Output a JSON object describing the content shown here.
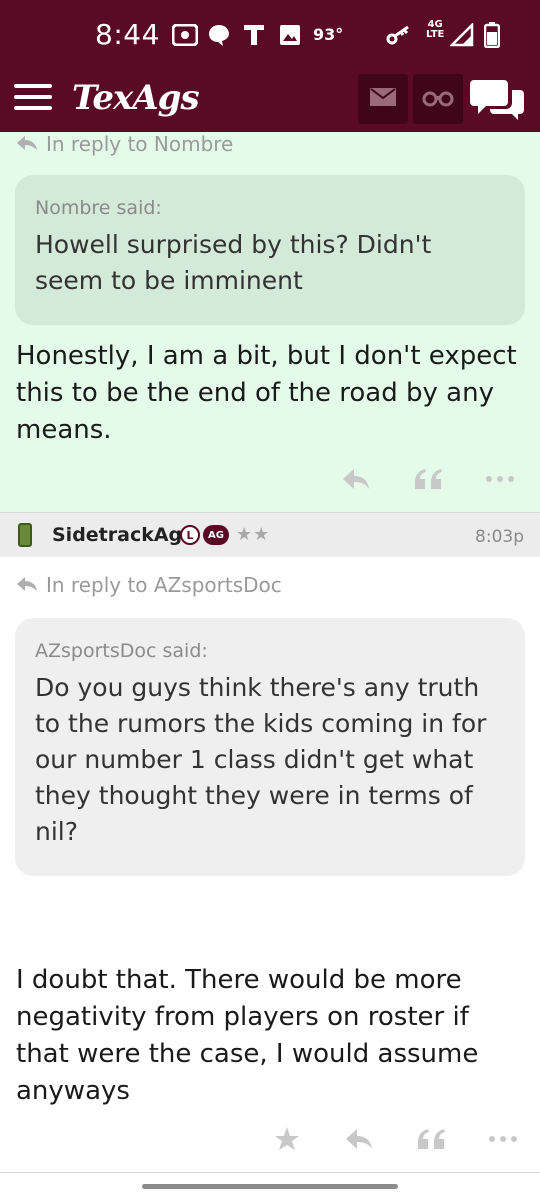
{
  "status_bar": {
    "time": "8:44",
    "temperature": "93°",
    "network_top": "4G",
    "network_bottom": "LTE",
    "icons": [
      "radio-icon",
      "message-icon",
      "t-mobile-icon",
      "image-icon",
      "key-icon",
      "signal-icon",
      "battery-icon"
    ]
  },
  "header": {
    "logo": "TexAgs",
    "icons": [
      "menu-icon",
      "mail-icon",
      "binoculars-icon",
      "chat-icon"
    ]
  },
  "posts": [
    {
      "reply_to": "In reply to Nombre",
      "quote_author": "Nombre said:",
      "quote_text": "Howell surprised by this? Didn't seem to be imminent",
      "body": "Honestly, I am a bit, but I don't expect this to be the end of the road by any means."
    },
    {
      "username": "SidetrackAg",
      "badge_l": "L",
      "badge_ag": "AG",
      "stars": "★★",
      "time": "8:03p",
      "reply_to": "In reply to AZsportsDoc",
      "quote_author": "AZsportsDoc said:",
      "quote_text": "Do you guys think there's any truth to the rumors the kids coming in for our number 1 class didn't get what they thought they were in terms of nil?",
      "body": "I doubt that. There would be more negativity from players on roster if that were the case, I would assume anyways"
    }
  ],
  "colors": {
    "brand": "#5a0a24",
    "highlight": "#e4fbea"
  }
}
